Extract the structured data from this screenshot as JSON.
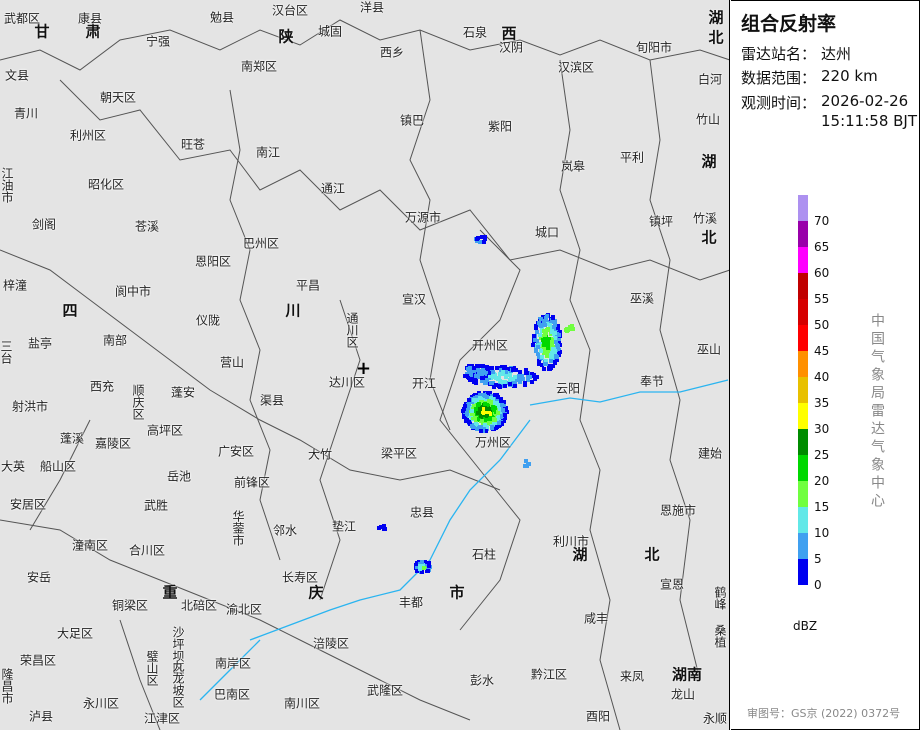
{
  "panel": {
    "title": "组合反射率",
    "station_label": "雷达站名：",
    "station": "达州",
    "range_label": "数据范围：",
    "range": "220 km",
    "time_label": "观测时间：",
    "date": "2026-02-26",
    "time": "15:11:58 BJT",
    "unit": "dBZ",
    "agency": "中国气象局雷达气象中心",
    "approval": "审图号：GS京 (2022) 0372号"
  },
  "colorbar": {
    "colors": [
      "#ad91f0",
      "#9900aa",
      "#ff00ff",
      "#c00000",
      "#d60000",
      "#ff0000",
      "#ff9000",
      "#e8c000",
      "#ffff00",
      "#008c00",
      "#00d800",
      "#70ff40",
      "#62e8e8",
      "#40a0f0",
      "#0000f0"
    ],
    "ticks": [
      "70",
      "65",
      "60",
      "55",
      "50",
      "45",
      "40",
      "35",
      "30",
      "25",
      "20",
      "15",
      "10",
      "5",
      "0"
    ]
  },
  "provinces": [
    "甘",
    "肃",
    "陕",
    "西",
    "湖",
    "北",
    "湖",
    "北",
    "四",
    "川",
    "湖",
    "北",
    "重",
    "庆",
    "市",
    "湖南"
  ],
  "places": [
    "武都区",
    "康县",
    "勉县",
    "汉台区",
    "城固",
    "洋县",
    "石泉",
    "汉阴",
    "旬阳市",
    "西乡",
    "宁强",
    "南郑区",
    "汉滨区",
    "白河",
    "文县",
    "朝天区",
    "青川",
    "利州区",
    "旺苍",
    "南江",
    "镇巴",
    "紫阳",
    "岚皋",
    "平利",
    "竹山",
    "江油市",
    "昭化区",
    "通江",
    "万源市",
    "镇坪",
    "竹溪",
    "城口",
    "剑阁",
    "苍溪",
    "巴州区",
    "恩阳区",
    "平昌",
    "梓潼",
    "阆中市",
    "仪陇",
    "宣汉",
    "巫溪",
    "盐亭",
    "南部",
    "通川区",
    "开州区",
    "巫山",
    "营山",
    "达川区",
    "开江",
    "云阳",
    "奉节",
    "西充",
    "顺庆区",
    "蓬安",
    "射洪市",
    "渠县",
    "高坪区",
    "蓬溪",
    "嘉陵区",
    "广安区",
    "大竹",
    "梁平区",
    "万州区",
    "建始",
    "船山区",
    "大英",
    "岳池",
    "前锋区",
    "安居区",
    "武胜",
    "华蓥市",
    "邻水",
    "垫江",
    "忠县",
    "恩施市",
    "潼南区",
    "合川区",
    "石柱",
    "利川市",
    "长寿区",
    "安岳",
    "铜梁区",
    "北碚区",
    "丰都",
    "宣恩",
    "鹤峰",
    "渝北区",
    "大足区",
    "涪陵区",
    "咸丰",
    "荣昌区",
    "沙坪坝区",
    "璧山区",
    "九龙坡区",
    "南岸区",
    "来凤",
    "彭水",
    "黔江区",
    "龙山",
    "隆昌市",
    "永川区",
    "巴南区",
    "南川区",
    "武隆区",
    "泸县",
    "江津区",
    "酉阳",
    "永顺",
    "桑植",
    "三台"
  ]
}
